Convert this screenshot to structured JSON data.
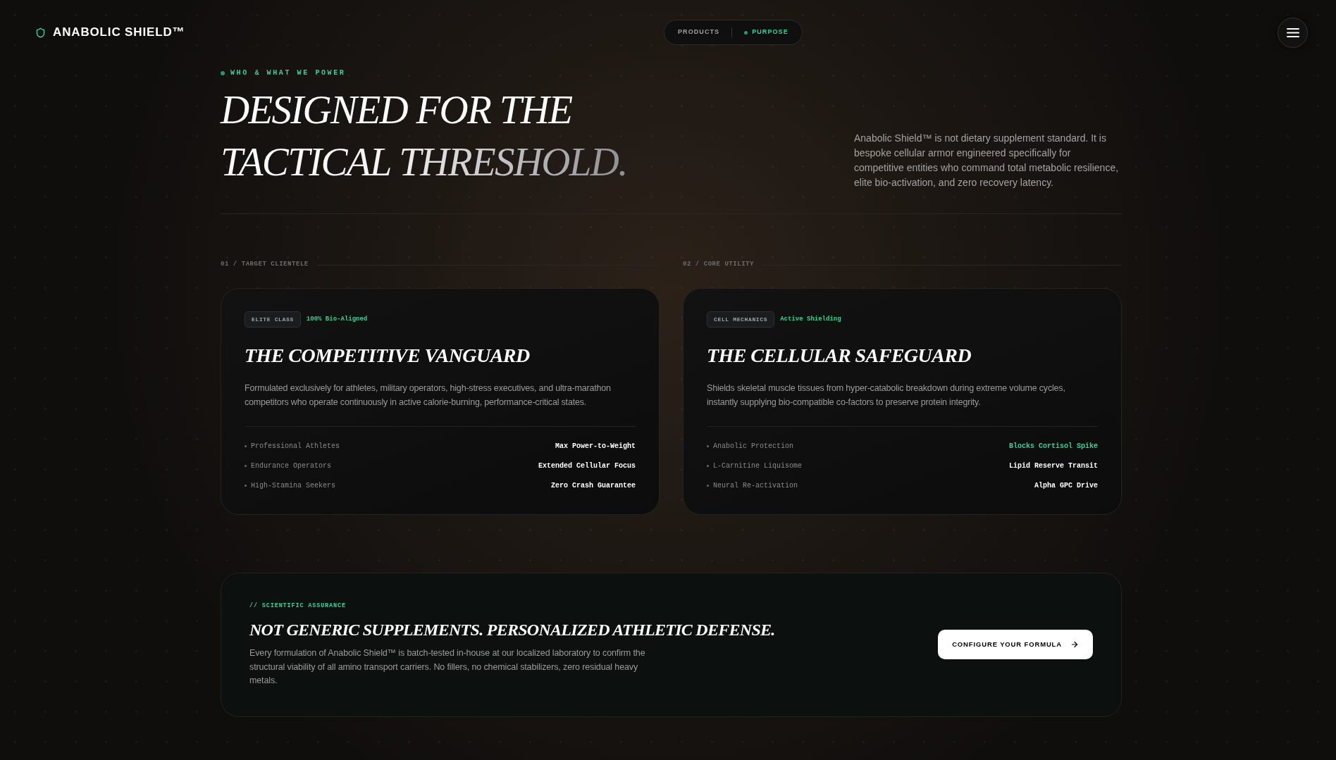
{
  "header": {
    "logo": "ANABOLIC SHIELD™",
    "nav": [
      {
        "label": "PRODUCTS",
        "selected": false
      },
      {
        "label": "PURPOSE",
        "selected": true
      }
    ]
  },
  "hero": {
    "eyebrow": "WHO & WHAT WE POWER",
    "title_lines": [
      {
        "text": "DESIGNED FOR THE",
        "gradient": false
      },
      {
        "text": "TACTICAL THRESHOLD.",
        "gradient": true
      }
    ],
    "intro": "Anabolic Shield™ is not dietary supplement standard. It is bespoke cellular armor engineered specifically for competitive entities who command total metabolic resilience, elite bio-activation, and zero recovery latency."
  },
  "sections": [
    {
      "label": "01 / TARGET CLIENTELE",
      "card": {
        "badge": "ELITE CLASS",
        "tag": "100% Bio-Aligned",
        "title": "THE COMPETITIVE VANGUARD",
        "description": "Formulated exclusively for athletes, military operators, high-stress executives, and ultra-marathon competitors who operate continuously in active calorie-burning, performance-critical states.",
        "rows": [
          {
            "label": "Professional Athletes",
            "value": "Max Power-to-Weight",
            "highlighted": false
          },
          {
            "label": "Endurance Operators",
            "value": "Extended Cellular Focus",
            "highlighted": false
          },
          {
            "label": "High-Stamina Seekers",
            "value": "Zero Crash Guarantee",
            "highlighted": false
          }
        ]
      }
    },
    {
      "label": "02 / CORE UTILITY",
      "card": {
        "badge": "CELL MECHANICS",
        "tag": "Active Shielding",
        "title": "THE CELLULAR SAFEGUARD",
        "description": "Shields skeletal muscle tissues from hyper-catabolic breakdown during extreme volume cycles, instantly supplying bio-compatible co-factors to preserve protein integrity.",
        "rows": [
          {
            "label": "Anabolic Protection",
            "value": "Blocks Cortisol Spike",
            "highlighted": true
          },
          {
            "label": "L-Carnitine Liquisome",
            "value": "Lipid Reserve Transit",
            "highlighted": false
          },
          {
            "label": "Neural Re-activation",
            "value": "Alpha GPC Drive",
            "highlighted": false
          }
        ]
      }
    }
  ],
  "assurance": {
    "eyebrow": "// SCIENTIFIC ASSURANCE",
    "title": "NOT GENERIC SUPPLEMENTS. PERSONALIZED ATHLETIC DEFENSE.",
    "text": "Every formulation of Anabolic Shield™ is batch-tested in-house at our localized laboratory to confirm the structural viability of all amino transport carriers. No fillers, no chemical stabilizers, zero residual heavy metals.",
    "button": "CONFIGURE YOUR FORMULA"
  }
}
